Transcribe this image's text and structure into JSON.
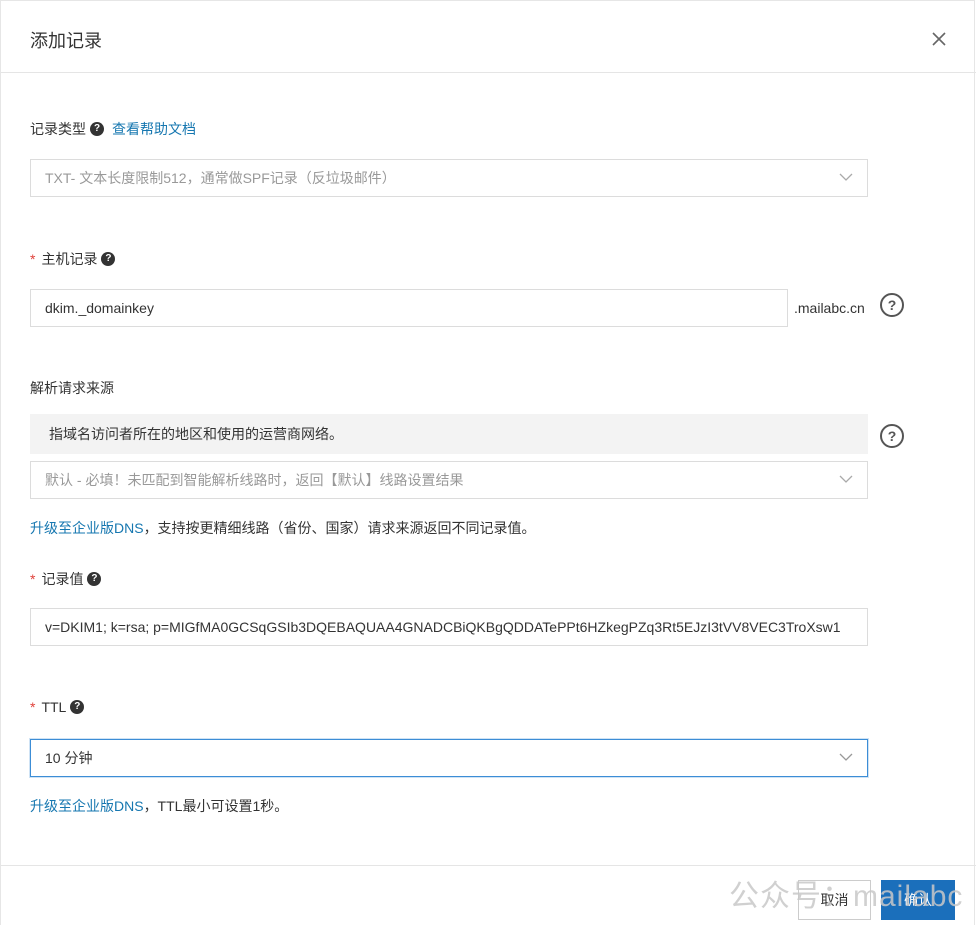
{
  "dialog": {
    "title": "添加记录"
  },
  "record_type": {
    "label": "记录类型",
    "help_link": "查看帮助文档",
    "value": "TXT- 文本长度限制512，通常做SPF记录（反垃圾邮件）"
  },
  "host": {
    "label": "主机记录",
    "value": "dkim._domainkey",
    "suffix": ".mailabc.cn"
  },
  "source": {
    "label": "解析请求来源",
    "hint": "指域名访问者所在的地区和使用的运营商网络。",
    "value": "默认 - 必填！未匹配到智能解析线路时，返回【默认】线路设置结果",
    "upgrade_link": "升级至企业版DNS",
    "upgrade_note": "，支持按更精细线路（省份、国家）请求来源返回不同记录值。"
  },
  "record_value": {
    "label": "记录值",
    "value": "v=DKIM1; k=rsa; p=MIGfMA0GCSqGSIb3DQEBAQUAA4GNADCBiQKBgQDDATePPt6HZkegPZq3Rt5EJzI3tVV8VEC3TroXsw1"
  },
  "ttl": {
    "label": "TTL",
    "value": "10 分钟",
    "upgrade_link": "升级至企业版DNS",
    "upgrade_note": "，TTL最小可设置1秒。"
  },
  "footer": {
    "cancel": "取消",
    "confirm": "确认"
  },
  "watermark": "公众号：mailabc",
  "icons": {
    "close": "close-icon",
    "help": "question-icon",
    "dropdown": "chevron-down-icon"
  },
  "colors": {
    "link": "#1677b0",
    "required": "#e0413a",
    "primary": "#1b6fbb",
    "focus": "#3c8dd6"
  }
}
